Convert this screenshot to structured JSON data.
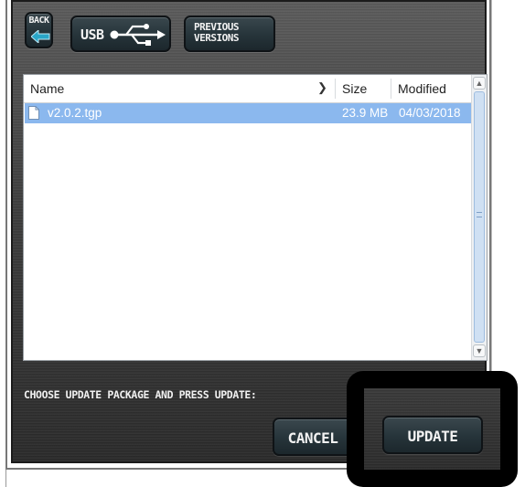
{
  "toolbar": {
    "back_label": "BACK",
    "usb_label": "USB",
    "previous_versions_label": "PREVIOUS VERSIONS"
  },
  "file_list": {
    "columns": {
      "name": "Name",
      "size": "Size",
      "modified": "Modified"
    },
    "rows": [
      {
        "name": "v2.0.2.tgp",
        "size": "23.9 MB",
        "modified": "04/03/2018",
        "selected": true
      }
    ]
  },
  "footer": {
    "instruction": "CHOOSE UPDATE PACKAGE AND PRESS UPDATE:",
    "cancel_label": "CANCEL",
    "update_label": "UPDATE"
  },
  "colors": {
    "selection": "#8bb8ee",
    "panel": "#3e3e3e",
    "highlight_border": "#000000"
  }
}
